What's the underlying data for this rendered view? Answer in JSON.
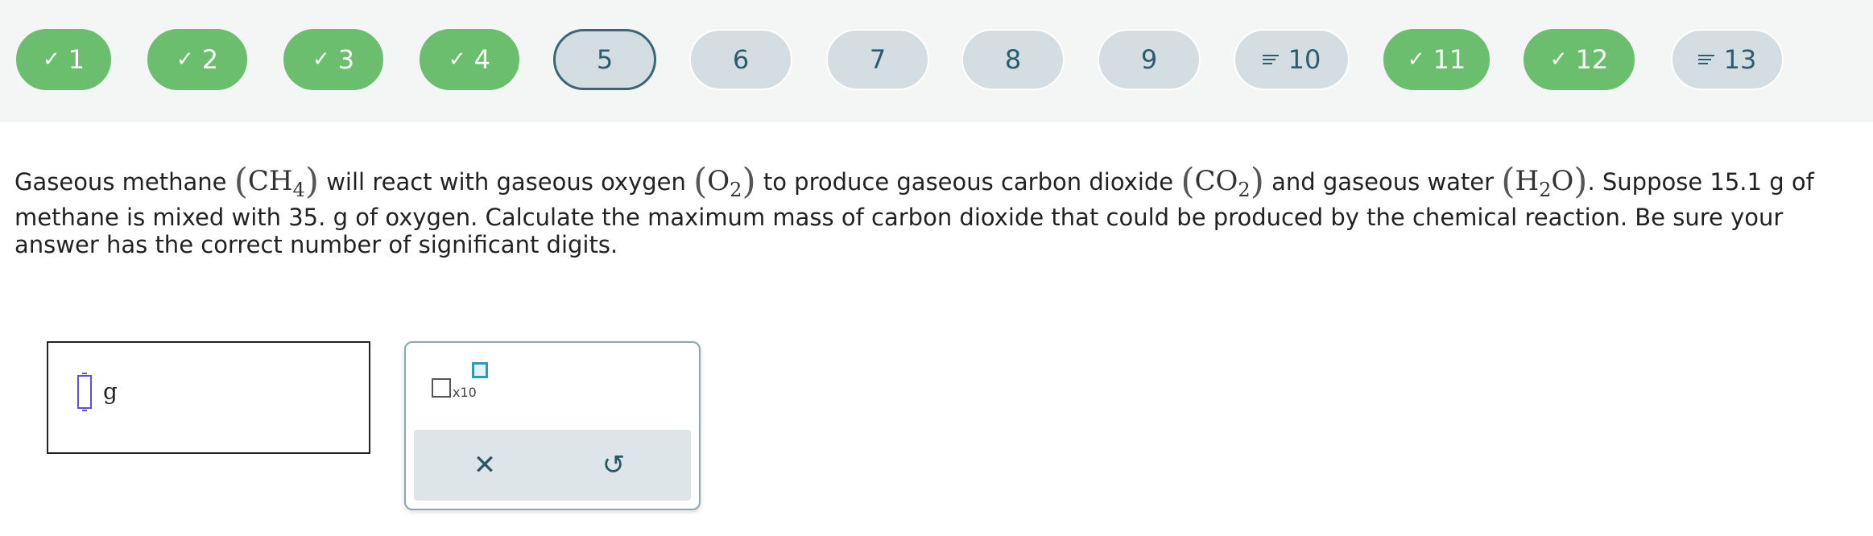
{
  "question_nav": [
    {
      "label": "1",
      "status": "done"
    },
    {
      "label": "2",
      "status": "done"
    },
    {
      "label": "3",
      "status": "done"
    },
    {
      "label": "4",
      "status": "done"
    },
    {
      "label": "5",
      "status": "current"
    },
    {
      "label": "6",
      "status": "todo"
    },
    {
      "label": "7",
      "status": "todo"
    },
    {
      "label": "8",
      "status": "todo"
    },
    {
      "label": "9",
      "status": "todo"
    },
    {
      "label": "10",
      "status": "partial"
    },
    {
      "label": "11",
      "status": "done"
    },
    {
      "label": "12",
      "status": "done"
    },
    {
      "label": "13",
      "status": "partial"
    }
  ],
  "question": {
    "t1": "Gaseous methane ",
    "ch": "CH",
    "ch_sub": "4",
    "t2": " will react with gaseous oxygen ",
    "o": "O",
    "o_sub": "2",
    "t3": " to produce gaseous carbon dioxide ",
    "co": "CO",
    "co_sub": "2",
    "t4": " and gaseous water ",
    "h": "H",
    "h_sub": "2",
    "h_tail": "O",
    "t5": ". Suppose 15.1 g of methane is mixed with 35. g of oxygen. Calculate the maximum mass of carbon dioxide that could be produced by the chemical reaction. Be sure your answer has the correct number of significant digits."
  },
  "answer": {
    "value": "",
    "unit": "g"
  },
  "keypad": {
    "x10_label": "x10",
    "clear_symbol": "✕",
    "undo_symbol": "↺"
  },
  "colors": {
    "done": "#6abe6e",
    "todo": "#d4dde1",
    "current_border": "#3b6673",
    "text_dark": "#2c5c6e"
  }
}
